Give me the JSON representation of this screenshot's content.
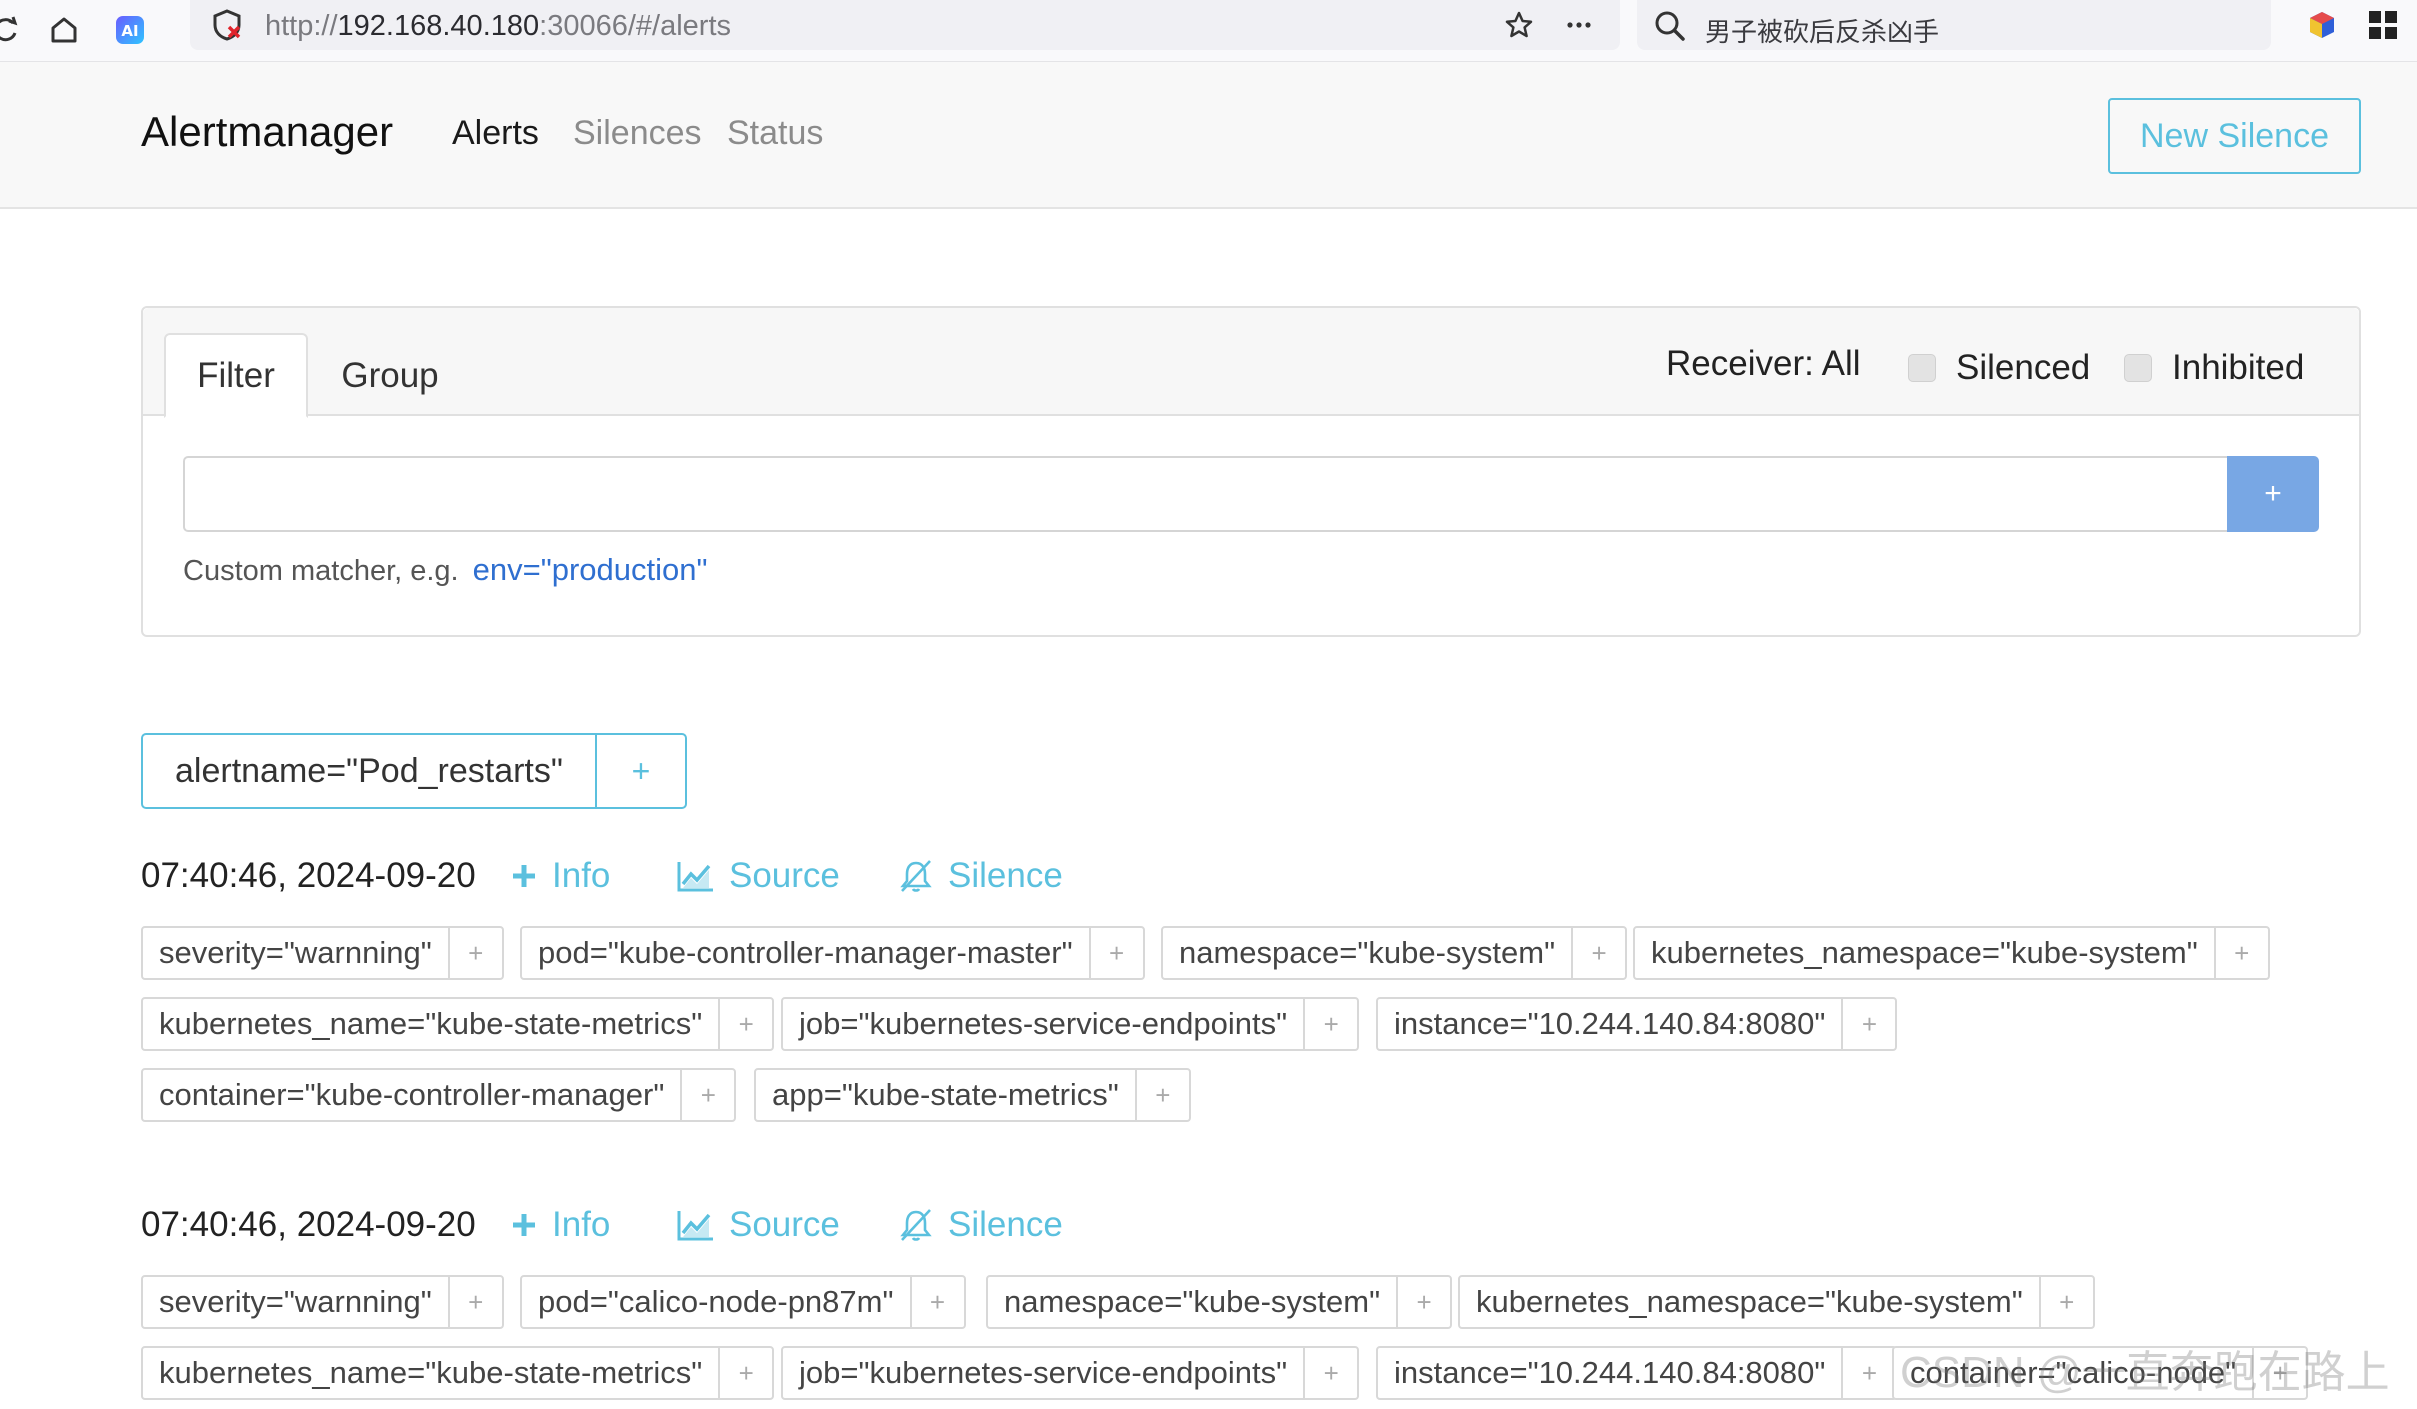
{
  "browser": {
    "url_prefix": "http://",
    "url_host": "192.168.40.180",
    "url_rest": ":30066/#/alerts",
    "search_text": "男子被砍后反杀凶手"
  },
  "navbar": {
    "brand": "Alertmanager",
    "links": [
      "Alerts",
      "Silences",
      "Status"
    ],
    "new_silence": "New Silence"
  },
  "filter": {
    "tabs": [
      "Filter",
      "Group"
    ],
    "receiver": "Receiver: All",
    "silenced_label": "Silenced",
    "inhibited_label": "Inhibited",
    "add_label": "+",
    "hint": "Custom matcher, e.g.",
    "example": "env=\"production\""
  },
  "group": {
    "label": "alertname=\"Pod_restarts\"",
    "plus": "+"
  },
  "actions": {
    "info": "Info",
    "source": "Source",
    "silence": "Silence"
  },
  "alerts": [
    {
      "timestamp": "07:40:46, 2024-09-20",
      "rows": [
        [
          "severity=\"warnning\"",
          "pod=\"kube-controller-manager-master\"",
          "namespace=\"kube-system\"",
          "kubernetes_namespace=\"kube-system\""
        ],
        [
          "kubernetes_name=\"kube-state-metrics\"",
          "job=\"kubernetes-service-endpoints\"",
          "instance=\"10.244.140.84:8080\""
        ],
        [
          "container=\"kube-controller-manager\"",
          "app=\"kube-state-metrics\""
        ]
      ]
    },
    {
      "timestamp": "07:40:46, 2024-09-20",
      "rows": [
        [
          "severity=\"warnning\"",
          "pod=\"calico-node-pn87m\"",
          "namespace=\"kube-system\"",
          "kubernetes_namespace=\"kube-system\""
        ],
        [
          "kubernetes_name=\"kube-state-metrics\"",
          "job=\"kubernetes-service-endpoints\"",
          "instance=\"10.244.140.84:8080\"",
          "container=\"calico-node\""
        ]
      ]
    }
  ],
  "label_plus": "+",
  "watermark": "CSDN @一直奔跑在路上",
  "colors": {
    "accent": "#5bc0de",
    "primary_button": "#78a7e4",
    "link_blue": "#2f6fd0"
  }
}
